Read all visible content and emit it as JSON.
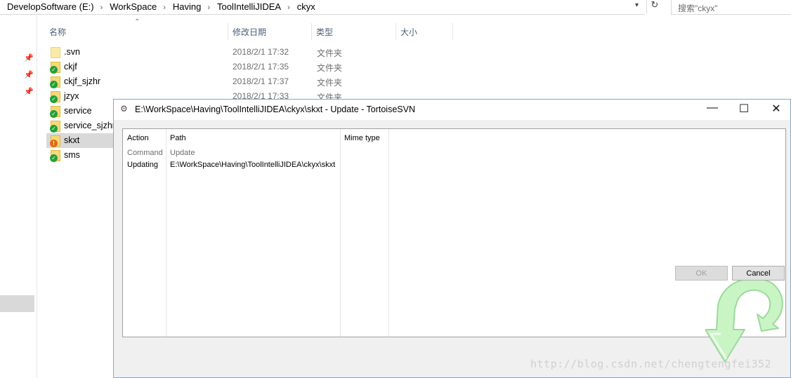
{
  "address_bar": {
    "crumbs": [
      "DevelopSoftware (E:)",
      "WorkSpace",
      "Having",
      "ToolIntelliJIDEA",
      "ckyx"
    ],
    "separator": "›",
    "search_placeholder": "搜索\"ckyx\""
  },
  "columns": {
    "name": "名称",
    "date": "修改日期",
    "type": "类型",
    "size": "大小"
  },
  "files": [
    {
      "name": ".svn",
      "date": "2018/2/1 17:32",
      "type": "文件夹",
      "status": "none"
    },
    {
      "name": "ckjf",
      "date": "2018/2/1 17:35",
      "type": "文件夹",
      "status": "normal"
    },
    {
      "name": "ckjf_sjzhr",
      "date": "2018/2/1 17:37",
      "type": "文件夹",
      "status": "normal"
    },
    {
      "name": "jzyx",
      "date": "2018/2/1 17:33",
      "type": "文件夹",
      "status": "normal"
    },
    {
      "name": "service",
      "status": "normal"
    },
    {
      "name": "service_sjzhr",
      "status": "normal"
    },
    {
      "name": "skxt",
      "status": "modified"
    },
    {
      "name": "sms",
      "status": "normal"
    }
  ],
  "dialog": {
    "title": "E:\\WorkSpace\\Having\\ToolIntelliJIDEA\\ckyx\\skxt - Update - TortoiseSVN",
    "minimize": "—",
    "maximize": "☐",
    "close": "✕",
    "headers": {
      "action": "Action",
      "path": "Path",
      "mime": "Mime type"
    },
    "rows": [
      {
        "action": "Command",
        "path": "Update"
      },
      {
        "action": "Updating",
        "path": "E:\\WorkSpace\\Having\\ToolIntelliJIDEA\\ckyx\\skxt"
      }
    ],
    "ok_label": "OK",
    "cancel_label": "Cancel"
  },
  "watermark": "http://blog.csdn.net/chengtengfei352",
  "colors": {
    "ok_badge": "#22a037",
    "modified_badge": "#e06a14",
    "arrow_fill": "#c9f5c5"
  },
  "icons": {
    "folder": "folder-icon",
    "ok": "check-badge-icon",
    "modified": "warning-badge-icon",
    "pin": "pin-icon",
    "dialog": "tortoisesvn-icon",
    "update": "update-arrow-icon"
  }
}
